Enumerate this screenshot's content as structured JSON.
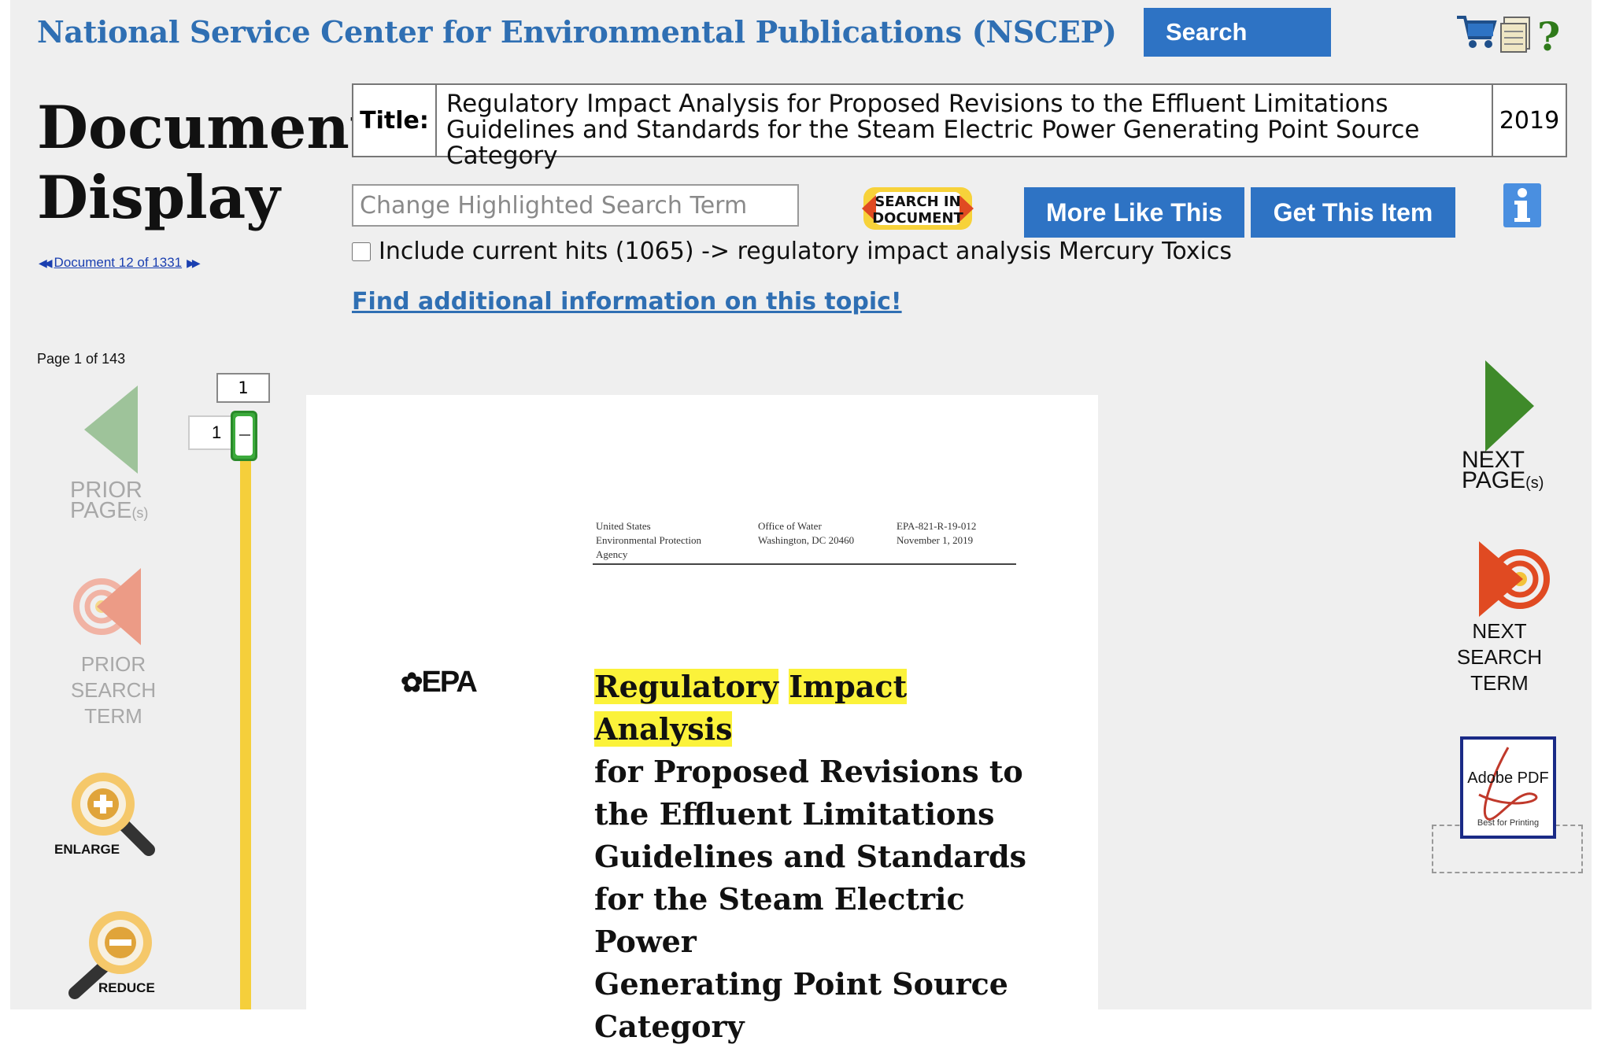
{
  "header": {
    "site_title": "National Service Center for Environmental Publications (NSCEP)",
    "search_label": "Search",
    "icons": [
      "cart-icon",
      "documents-icon",
      "help-icon"
    ]
  },
  "sidebar": {
    "heading_line1": "Document",
    "heading_line2": "Display",
    "doc_nav": "Document 12 of 1331",
    "page_of": "Page 1 of 143"
  },
  "record": {
    "title_label": "Title:",
    "title": "Regulatory Impact Analysis for Proposed Revisions to the Effluent Limitations Guidelines and Standards for the Steam Electric Power Generating Point Source Category",
    "year": "2019"
  },
  "toolbar": {
    "highlight_placeholder": "Change Highlighted Search Term",
    "search_in_doc_line1": "SEARCH IN",
    "search_in_doc_line2": "DOCUMENT",
    "more_like_this": "More Like This",
    "get_this_item": "Get This Item",
    "include_hits": "Include current hits (1065) -> regulatory impact analysis Mercury Toxics",
    "find_more": "Find additional information on this topic!"
  },
  "controls": {
    "prior_page_line1": "PRIOR",
    "prior_page_line2": "PAGE",
    "prior_page_suffix": "(s)",
    "prior_search_line1": "PRIOR",
    "prior_search_line2": "SEARCH",
    "prior_search_line3": "TERM",
    "enlarge": "ENLARGE",
    "reduce": "REDUCE",
    "next_page_line1": "NEXT",
    "next_page_line2": "PAGE",
    "next_page_suffix": "(s)",
    "next_search_line1": "NEXT",
    "next_search_line2": "SEARCH",
    "next_search_line3": "TERM",
    "pdf_label": "Adobe PDF",
    "pdf_sub": "Best for Printing"
  },
  "slider": {
    "top_value": "1",
    "input_value": "1",
    "position": 0
  },
  "document": {
    "hdr_col1_line1": "United States",
    "hdr_col1_line2": "Environmental Protection",
    "hdr_col1_line3": "Agency",
    "hdr_col2_line1": "Office of Water",
    "hdr_col2_line2": "Washington, DC 20460",
    "hdr_col3_line1": "EPA-821-R-19-012",
    "hdr_col3_line2": "November 1, 2019",
    "logo_text": "EPA",
    "title_hl1": "Regulatory",
    "title_hl2": "Impact",
    "title_hl3": "Analysis",
    "title_rest": [
      "for Proposed Revisions to",
      "the Effluent Limitations",
      "Guidelines and Standards",
      "for the Steam Electric Power",
      "Generating Point Source",
      "Category"
    ]
  },
  "colors": {
    "accent_blue": "#2e73c4",
    "title_blue": "#2f6fb3",
    "highlight": "#fbf23a",
    "slider_track": "#f5cf3b",
    "slider_thumb": "#3cab3c"
  }
}
